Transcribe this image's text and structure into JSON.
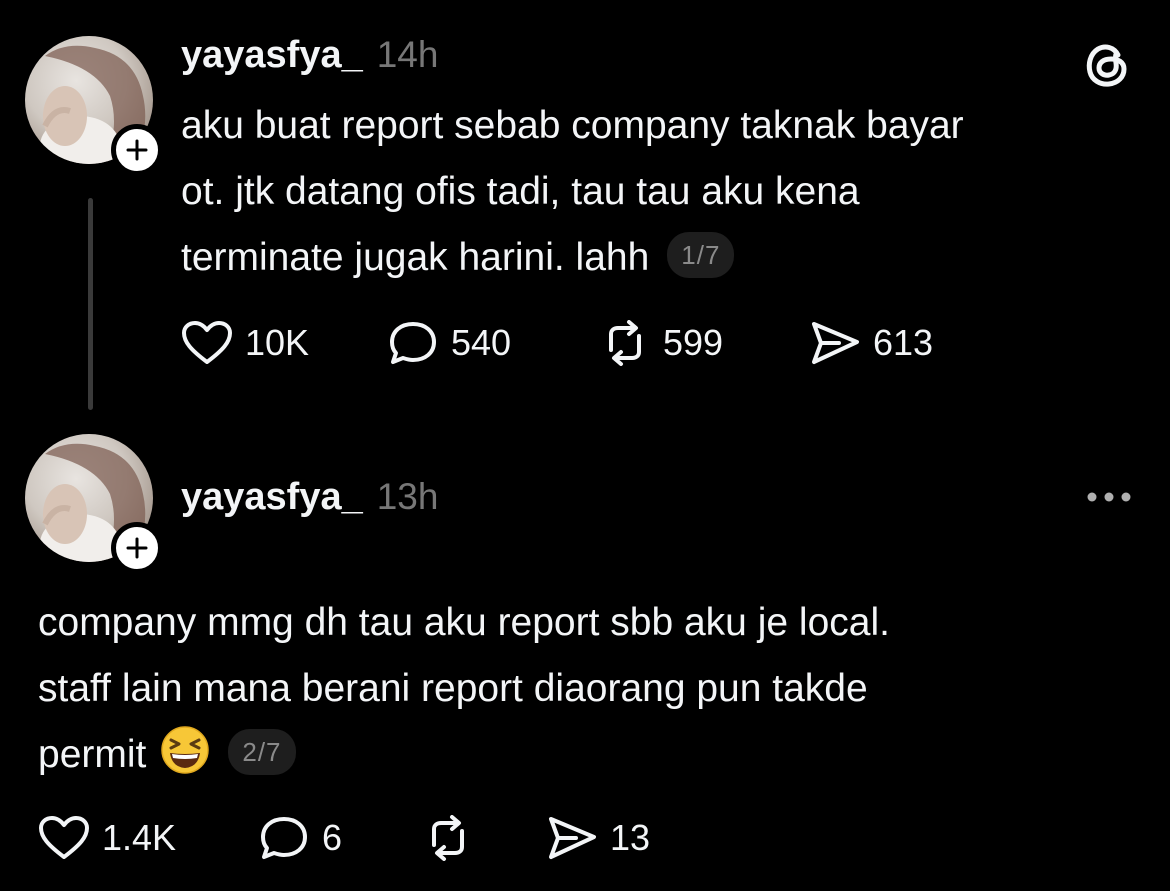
{
  "posts": [
    {
      "username": "yayasfya_",
      "time": "14h",
      "text_lines": [
        "aku buat report sebab company taknak bayar",
        "ot. jtk datang ofis tadi, tau tau aku kena",
        "terminate jugak harini. lahh"
      ],
      "page_indicator": "1/7",
      "actions": {
        "likes": "10K",
        "replies": "540",
        "reposts": "599",
        "shares": "613"
      },
      "top_right_icon": "threads-logo-icon"
    },
    {
      "username": "yayasfya_",
      "time": "13h",
      "text_lines": [
        "company mmg dh tau aku report sbb aku je local.",
        "staff lain mana berani report diaorang pun takde",
        "permit"
      ],
      "emoji": "grinning-squinting-face",
      "page_indicator": "2/7",
      "actions": {
        "likes": "1.4K",
        "replies": "6",
        "reposts": "",
        "shares": "13"
      },
      "top_right_icon": "more-options-icon"
    }
  ],
  "colors": {
    "background": "#000000",
    "text": "#f3f5f7",
    "secondary": "#777777",
    "thread_line": "#3a3a3a"
  }
}
